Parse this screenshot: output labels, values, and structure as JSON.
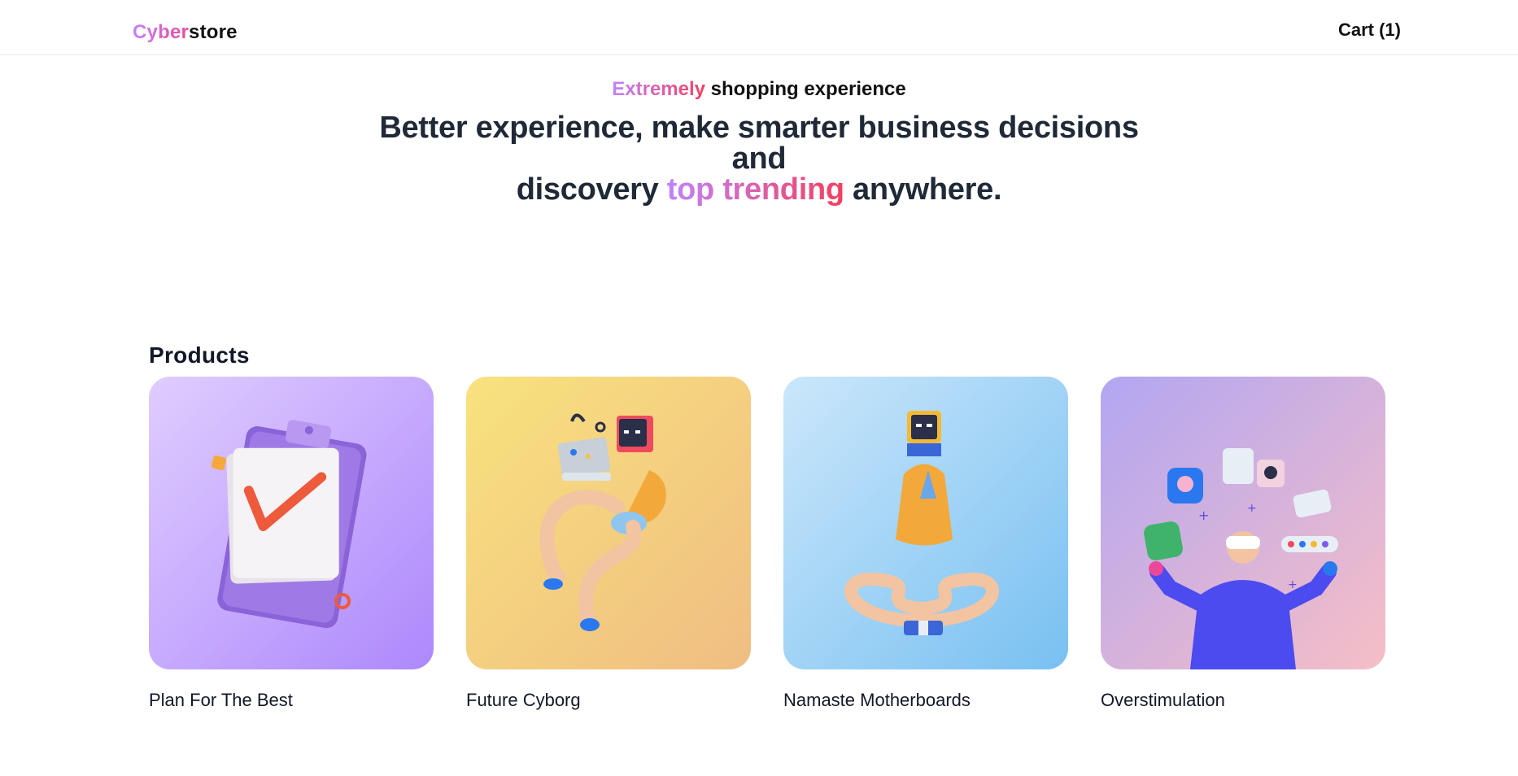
{
  "nav": {
    "logo_part1": "Cyber",
    "logo_part2": "store",
    "cart_label": "Cart (1)"
  },
  "hero": {
    "eyebrow_highlight": "Extremely",
    "eyebrow_rest": " shopping experience",
    "title_line1": "Better experience, make smarter business decisions and",
    "title_line2_start": "discovery ",
    "title_highlight": "top trending",
    "title_line2_end": " anywhere."
  },
  "products": {
    "heading": "Products",
    "items": [
      {
        "title": "Plan For The Best",
        "illustration": "clipboard-checkmark",
        "bg_start": "#dcc8ff",
        "bg_end": "#b08cff"
      },
      {
        "title": "Future Cyborg",
        "illustration": "cyborg-with-laptop",
        "bg_start": "#f7df7a",
        "bg_end": "#f1c17f"
      },
      {
        "title": "Namaste Motherboards",
        "illustration": "meditating-robot",
        "bg_start": "#c9e7fb",
        "bg_end": "#7cc3f1"
      },
      {
        "title": "Overstimulation",
        "illustration": "vr-person-with-apps",
        "bg_start": "#b7a9f0",
        "bg_end": "#f3bcc7"
      }
    ]
  },
  "colors": {
    "accent_purple": "#c084fc",
    "accent_pink": "#ec4899",
    "accent_red": "#f43f5e",
    "text_dark": "#1f2937"
  }
}
